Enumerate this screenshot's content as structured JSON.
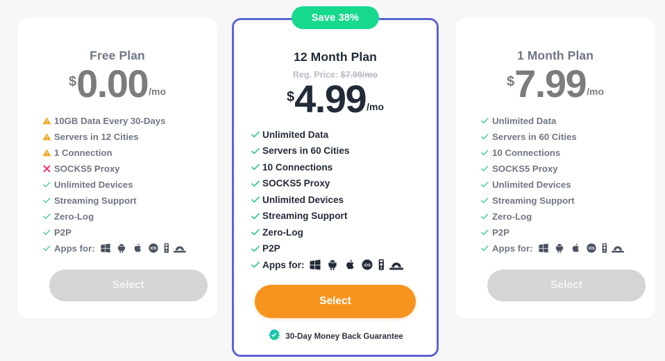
{
  "page": {
    "background_color": "#f7f7f8",
    "accent_purple": "#5b63d3",
    "accent_orange": "#f7941e",
    "accent_green": "#17d98e",
    "warning_color": "#f5a623",
    "cross_color": "#f5276c",
    "check_color": "#3dcd8e"
  },
  "plans": [
    {
      "id": "free",
      "title": "Free Plan",
      "currency": "$",
      "amount": "0.00",
      "period": "/mo",
      "featured": false,
      "features": [
        {
          "icon": "warning-icon",
          "label": "10GB Data Every 30-Days"
        },
        {
          "icon": "warning-icon",
          "label": "Servers in 12 Cities"
        },
        {
          "icon": "warning-icon",
          "label": "1 Connection"
        },
        {
          "icon": "cross-icon",
          "label": "SOCKS5 Proxy"
        },
        {
          "icon": "check-icon",
          "label": "Unlimited Devices"
        },
        {
          "icon": "check-icon",
          "label": "Streaming Support"
        },
        {
          "icon": "check-icon",
          "label": "Zero-Log"
        },
        {
          "icon": "check-icon",
          "label": "P2P"
        },
        {
          "icon": "check-icon",
          "label": "Apps for:",
          "apps": true
        }
      ],
      "button": {
        "label": "Select",
        "state": "disabled"
      }
    },
    {
      "id": "twelve-month",
      "title": "12 Month Plan",
      "badge": "Save 38%",
      "regular_price_prefix": "Reg. Price: ",
      "regular_price": "$7.99/mo",
      "currency": "$",
      "amount": "4.99",
      "period": "/mo",
      "featured": true,
      "features": [
        {
          "icon": "check-icon",
          "label": "Unlimited Data"
        },
        {
          "icon": "check-icon",
          "label": "Servers in 60 Cities"
        },
        {
          "icon": "check-icon",
          "label": "10 Connections"
        },
        {
          "icon": "check-icon",
          "label": "SOCKS5 Proxy"
        },
        {
          "icon": "check-icon",
          "label": "Unlimited Devices"
        },
        {
          "icon": "check-icon",
          "label": "Streaming Support"
        },
        {
          "icon": "check-icon",
          "label": "Zero-Log"
        },
        {
          "icon": "check-icon",
          "label": "P2P"
        },
        {
          "icon": "check-icon",
          "label": "Apps for:",
          "apps": true
        }
      ],
      "button": {
        "label": "Select",
        "state": "primary"
      },
      "guarantee": "30-Day Money Back Guarantee"
    },
    {
      "id": "one-month",
      "title": "1 Month Plan",
      "currency": "$",
      "amount": "7.99",
      "period": "/mo",
      "featured": false,
      "features": [
        {
          "icon": "check-icon",
          "label": "Unlimited Data"
        },
        {
          "icon": "check-icon",
          "label": "Servers in 60 Cities"
        },
        {
          "icon": "check-icon",
          "label": "10 Connections"
        },
        {
          "icon": "check-icon",
          "label": "SOCKS5 Proxy"
        },
        {
          "icon": "check-icon",
          "label": "Unlimited Devices"
        },
        {
          "icon": "check-icon",
          "label": "Streaming Support"
        },
        {
          "icon": "check-icon",
          "label": "Zero-Log"
        },
        {
          "icon": "check-icon",
          "label": "P2P"
        },
        {
          "icon": "check-icon",
          "label": "Apps for:",
          "apps": true
        }
      ],
      "button": {
        "label": "Select",
        "state": "disabled"
      }
    }
  ],
  "platform_icons": [
    "windows-icon",
    "android-icon",
    "apple-icon",
    "ios-icon",
    "firetv-stick-icon",
    "router-icon"
  ]
}
